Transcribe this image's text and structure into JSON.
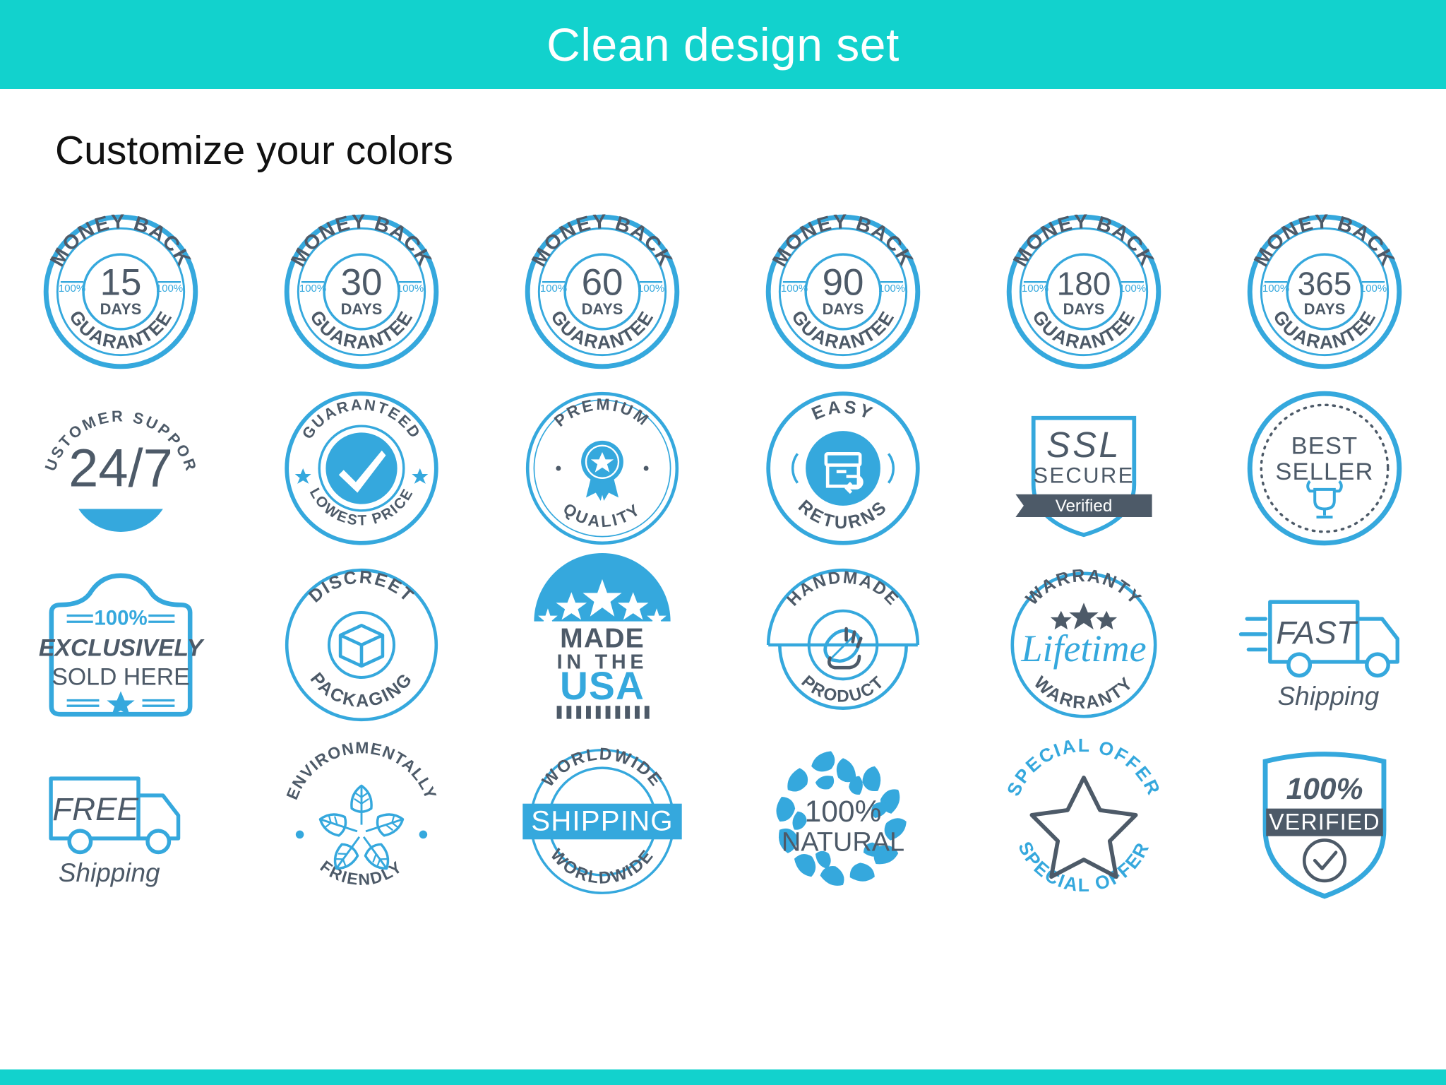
{
  "header": {
    "title": "Clean design set",
    "bg_color": "#12d2cd",
    "text_color": "#ffffff"
  },
  "subtitle": "Customize your colors",
  "palette": {
    "accent_teal": "#12d2cd",
    "badge_blue": "#35a8dd",
    "badge_slate": "#4d5a68",
    "white": "#ffffff"
  },
  "badges": [
    {
      "id": "money-back-15",
      "type": "money-back",
      "top": "MONEY BACK",
      "number": "15",
      "unit": "DAYS",
      "bottom": "GUARANTEE",
      "left_tag": "100%",
      "right_tag": "100%"
    },
    {
      "id": "money-back-30",
      "type": "money-back",
      "top": "MONEY BACK",
      "number": "30",
      "unit": "DAYS",
      "bottom": "GUARANTEE",
      "left_tag": "100%",
      "right_tag": "100%"
    },
    {
      "id": "money-back-60",
      "type": "money-back",
      "top": "MONEY BACK",
      "number": "60",
      "unit": "DAYS",
      "bottom": "GUARANTEE",
      "left_tag": "100%",
      "right_tag": "100%"
    },
    {
      "id": "money-back-90",
      "type": "money-back",
      "top": "MONEY BACK",
      "number": "90",
      "unit": "DAYS",
      "bottom": "GUARANTEE",
      "left_tag": "100%",
      "right_tag": "100%"
    },
    {
      "id": "money-back-180",
      "type": "money-back",
      "top": "MONEY BACK",
      "number": "180",
      "unit": "DAYS",
      "bottom": "GUARANTEE",
      "left_tag": "100%",
      "right_tag": "100%"
    },
    {
      "id": "money-back-365",
      "type": "money-back",
      "top": "MONEY BACK",
      "number": "365",
      "unit": "DAYS",
      "bottom": "GUARANTEE",
      "left_tag": "100%",
      "right_tag": "100%"
    },
    {
      "id": "customer-support-247",
      "type": "arc-text",
      "arc_text": "CUSTOMER  SUPPORT",
      "center": "24/7"
    },
    {
      "id": "guaranteed-lowest-price",
      "type": "check-seal",
      "top": "GUARANTEED",
      "bottom": "LOWEST PRICE",
      "icon": "check-icon"
    },
    {
      "id": "premium-quality",
      "type": "rosette-seal",
      "top": "PREMIUM",
      "bottom": "QUALITY",
      "icon": "award-ribbon-icon"
    },
    {
      "id": "easy-returns",
      "type": "disc-seal",
      "top": "EASY",
      "bottom": "RETURNS",
      "icon": "return-box-icon"
    },
    {
      "id": "ssl-secure",
      "type": "shield-ribbon",
      "line1": "SSL",
      "line2": "SECURE",
      "ribbon": "Verified"
    },
    {
      "id": "best-seller",
      "type": "dotted-circle",
      "line1": "BEST",
      "line2": "SELLER",
      "icon": "trophy-icon"
    },
    {
      "id": "exclusively-sold-here",
      "type": "plaque",
      "top": "100%",
      "line1": "EXCLUSIVELY",
      "line2": "SOLD HERE",
      "icon": "star-icon"
    },
    {
      "id": "discreet-packaging",
      "type": "circle-box",
      "top": "DISCREET",
      "bottom": "PACKAGING",
      "icon": "box-icon"
    },
    {
      "id": "made-in-the-usa",
      "type": "usa",
      "line1": "MADE",
      "line2": "IN THE",
      "line3": "USA"
    },
    {
      "id": "handmade-product",
      "type": "handmade",
      "top": "HANDMADE",
      "bottom": "PRODUCT",
      "icon": "hand-leaf-icon"
    },
    {
      "id": "lifetime-warranty",
      "type": "warranty",
      "top": "WARRANTY",
      "script": "Lifetime",
      "bottom": "WARRANTY"
    },
    {
      "id": "fast-shipping",
      "type": "truck",
      "line1": "FAST",
      "line2": "Shipping"
    },
    {
      "id": "free-shipping",
      "type": "truck",
      "line1": "FREE",
      "line2": "Shipping"
    },
    {
      "id": "environmentally-friendly",
      "type": "eco",
      "top": "ENVIRONMENTALLY",
      "bottom": "FRIENDLY",
      "icon": "leaves-icon"
    },
    {
      "id": "worldwide-shipping",
      "type": "worldwide",
      "top": "WORLDWIDE",
      "band": "SHIPPING",
      "bottom": "WORLDWIDE"
    },
    {
      "id": "100-natural",
      "type": "natural",
      "line1": "100%",
      "line2": "NATURAL",
      "icon": "leaf-wreath-icon"
    },
    {
      "id": "special-offer",
      "type": "special-offer",
      "top": "SPECIAL OFFER",
      "bottom": "SPECIAL OFFER",
      "icon": "star-outline-icon"
    },
    {
      "id": "100-verified",
      "type": "verified-shield",
      "line1": "100%",
      "band": "VERIFIED",
      "icon": "check-circle-icon"
    }
  ]
}
